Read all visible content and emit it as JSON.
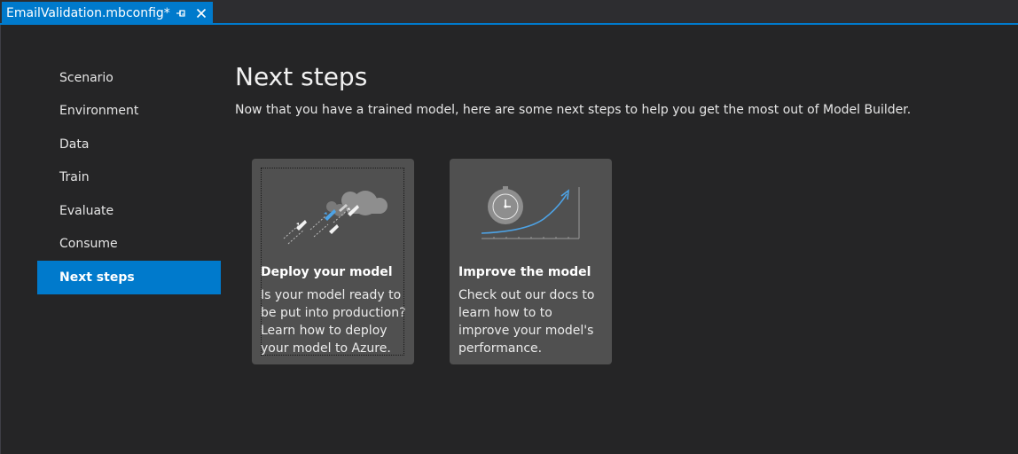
{
  "tab": {
    "title": "EmailValidation.mbconfig*",
    "pin_icon": "pin-icon",
    "close_icon": "close-icon"
  },
  "colors": {
    "accent": "#007acc",
    "background": "#252526",
    "card": "#505050"
  },
  "nav": {
    "items": [
      {
        "label": "Scenario",
        "active": false
      },
      {
        "label": "Environment",
        "active": false
      },
      {
        "label": "Data",
        "active": false
      },
      {
        "label": "Train",
        "active": false
      },
      {
        "label": "Evaluate",
        "active": false
      },
      {
        "label": "Consume",
        "active": false
      },
      {
        "label": "Next steps",
        "active": true
      }
    ]
  },
  "main": {
    "title": "Next steps",
    "subtitle": "Now that you have a trained model, here are some next steps to help you get the most out of Model Builder.",
    "cards": [
      {
        "icon": "rocket-cloud-icon",
        "title": "Deploy your model",
        "description": "Is your model ready to be put into production? Learn how to deploy your model to Azure.",
        "focused": true
      },
      {
        "icon": "clock-growth-chart-icon",
        "title": "Improve the model",
        "description": "Check out our docs to learn how to to improve your model's performance.",
        "focused": false
      }
    ]
  }
}
